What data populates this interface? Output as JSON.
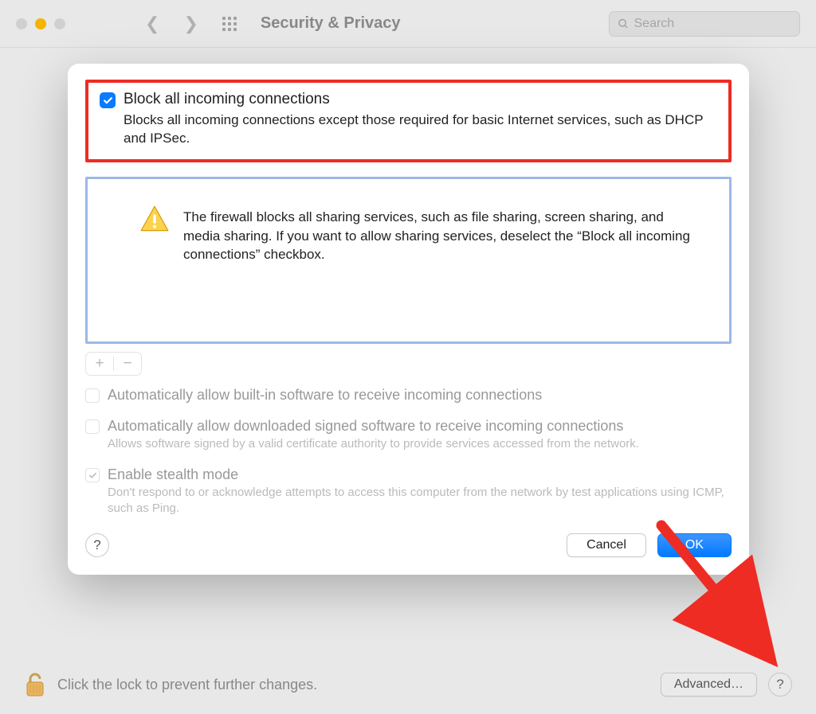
{
  "toolbar": {
    "title": "Security & Privacy",
    "search_placeholder": "Search"
  },
  "sheet": {
    "block_all": {
      "label": "Block all incoming connections",
      "desc": "Blocks all incoming connections except those required for basic Internet services, such as DHCP and IPSec.",
      "checked": true
    },
    "info_text": "The firewall blocks all sharing services, such as file sharing, screen sharing, and media sharing. If you want to allow sharing services, deselect the “Block all incoming connections” checkbox.",
    "auto_builtin": {
      "label": "Automatically allow built-in software to receive incoming connections",
      "checked": false
    },
    "auto_signed": {
      "label": "Automatically allow downloaded signed software to receive incoming connections",
      "desc": "Allows software signed by a valid certificate authority to provide services accessed from the network.",
      "checked": false
    },
    "stealth": {
      "label": "Enable stealth mode",
      "desc": "Don't respond to or acknowledge attempts to access this computer from the network by test applications using ICMP, such as Ping.",
      "checked": true
    },
    "cancel_label": "Cancel",
    "ok_label": "OK",
    "help_label": "?"
  },
  "bottom": {
    "lock_text": "Click the lock to prevent further changes.",
    "advanced_label": "Advanced…",
    "help_label": "?"
  }
}
